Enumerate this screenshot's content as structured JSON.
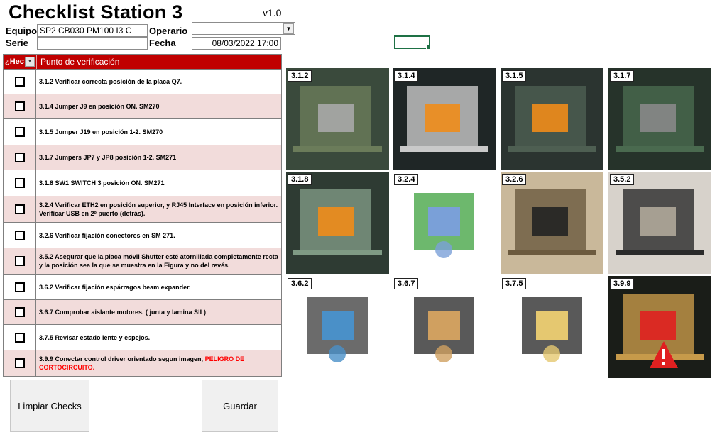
{
  "header": {
    "title": "Checklist Station 3",
    "version": "v1.0",
    "equipo_label": "Equipo",
    "equipo_value": "SP2 CB030 PM100 I3 C",
    "operario_label": "Operario",
    "operario_value": "",
    "serie_label": "Serie",
    "serie_value": "",
    "fecha_label": "Fecha",
    "fecha_value": "08/03/2022 17:00"
  },
  "table": {
    "col_done": "¿Hec",
    "col_point": "Punto de verificación",
    "rows": [
      {
        "text": "3.1.2 Verificar correcta posición de la placa Q7."
      },
      {
        "text": "3.1.4 Jumper J9 en posición ON. SM270"
      },
      {
        "text": "3.1.5 Jumper J19 en posición 1-2. SM270"
      },
      {
        "text": "3.1.7 Jumpers JP7 y JP8 posición 1-2. SM271"
      },
      {
        "text": "3.1.8 SW1 SWITCH 3 posición ON. SM271"
      },
      {
        "text": "3.2.4 Verificar ETH2 en posición superior, y RJ45 Interface en posición inferior. Verificar USB en 2º puerto (detrás)."
      },
      {
        "text": "3.2.6 Verificar fijación conectores en SM 271."
      },
      {
        "text": "3.5.2 Asegurar que la placa móvil Shutter esté atornillada completamente recta y la posición sea la que se muestra en la Figura y no del revés."
      },
      {
        "text": "3.6.2 Verificar fijación espárragos beam expander."
      },
      {
        "text": "3.6.7 Comprobar aislante motores. ( junta y lamina SIL)"
      },
      {
        "text": "3.7.5 Revisar estado lente y espejos."
      },
      {
        "text": "3.9.9 Conectar control driver orientado segun imagen, ",
        "warning": "PELIGRO DE CORTOCIRCUITO."
      }
    ]
  },
  "buttons": {
    "clear": "Limpiar Checks",
    "save": "Guardar"
  },
  "photos": [
    "3.1.2",
    "3.1.4",
    "3.1.5",
    "3.1.7",
    "3.1.8",
    "3.2.4",
    "3.2.6",
    "3.5.2",
    "3.6.2",
    "3.6.7",
    "3.7.5",
    "3.9.9"
  ],
  "colors": {
    "header_red": "#c00000",
    "row_pink": "#f2dcdb",
    "excel_green": "#1e7145",
    "warning_red": "#ff0000"
  }
}
